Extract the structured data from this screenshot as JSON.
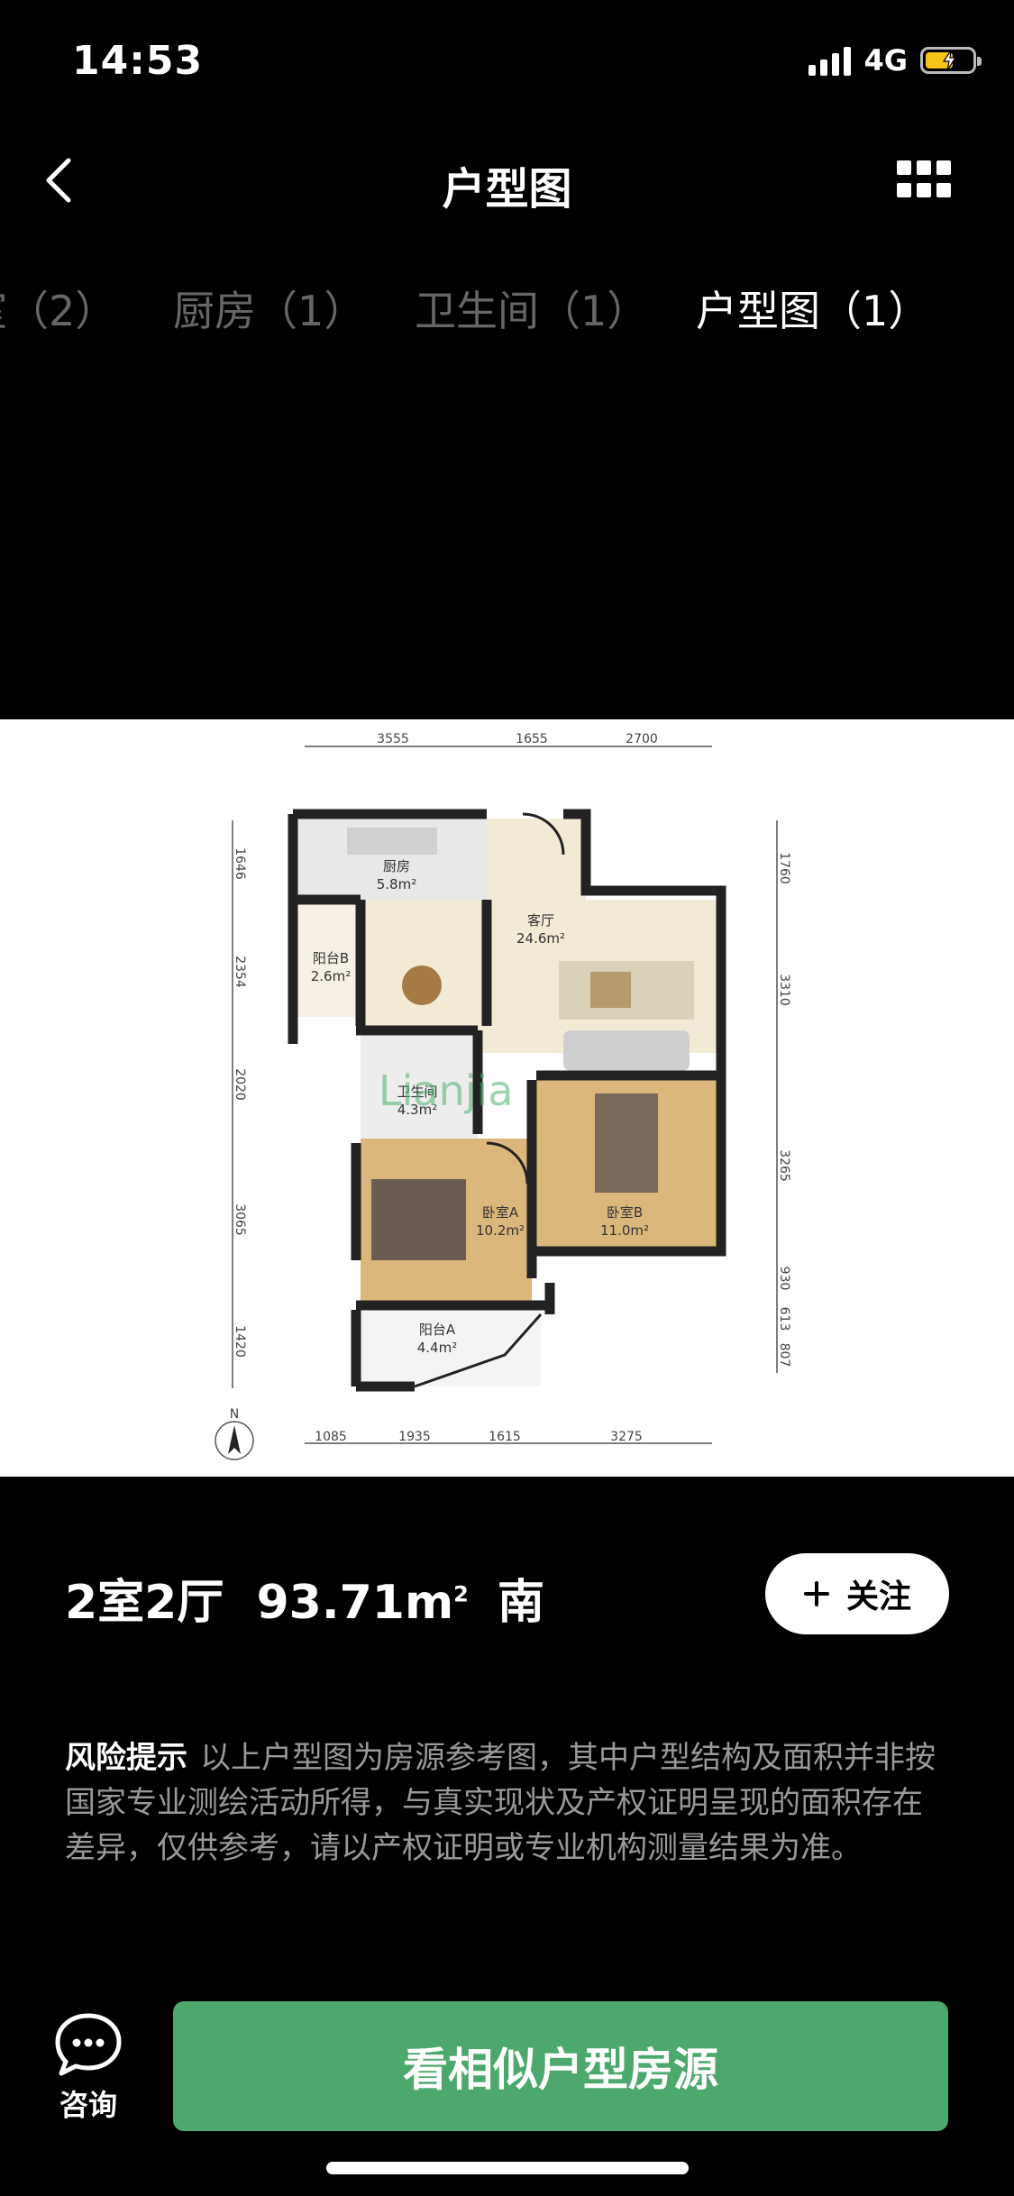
{
  "status_bar": {
    "time": "14:53",
    "network": "4G",
    "battery_color": "#f5c518"
  },
  "nav": {
    "title": "户型图"
  },
  "tabs": [
    {
      "label": "室（2）",
      "active": false
    },
    {
      "label": "厨房（1）",
      "active": false
    },
    {
      "label": "卫生间（1）",
      "active": false
    },
    {
      "label": "户型图（1）",
      "active": true
    }
  ],
  "floorplan": {
    "watermark": "Lianjia",
    "north": "N",
    "top_dims": [
      "3555",
      "1655",
      "2700"
    ],
    "bottom_dims": [
      "1085",
      "1935",
      "1615",
      "3275"
    ],
    "left_dims": [
      "1646",
      "2354",
      "2020",
      "3065",
      "1420"
    ],
    "right_dims": [
      "1760",
      "3310",
      "3265",
      "930",
      "613",
      "807"
    ],
    "rooms": {
      "kitchen": {
        "name": "厨房",
        "area": "5.8m²"
      },
      "living": {
        "name": "客厅",
        "area": "24.6m²"
      },
      "balcony_b": {
        "name": "阳台B",
        "area": "2.6m²"
      },
      "bath": {
        "name": "卫生间",
        "area": "4.3m²"
      },
      "bedroom_a": {
        "name": "卧室A",
        "area": "10.2m²"
      },
      "bedroom_b": {
        "name": "卧室B",
        "area": "11.0m²"
      },
      "balcony_a": {
        "name": "阳台A",
        "area": "4.4m²"
      }
    }
  },
  "summary": {
    "layout": "2室2厅",
    "area": "93.71m",
    "area_sup": "2",
    "orientation": "南"
  },
  "follow": {
    "label": "关注"
  },
  "risk": {
    "title": "风险提示",
    "text": "以上户型图为房源参考图，其中户型结构及面积并非按国家专业测绘活动所得，与真实现状及产权证明呈现的面积存在差异，仅供参考，请以产权证明或专业机构测量结果为准。"
  },
  "bottom": {
    "consult_label": "咨询",
    "cta_label": "看相似户型房源",
    "cta_color": "#4ca86c"
  }
}
